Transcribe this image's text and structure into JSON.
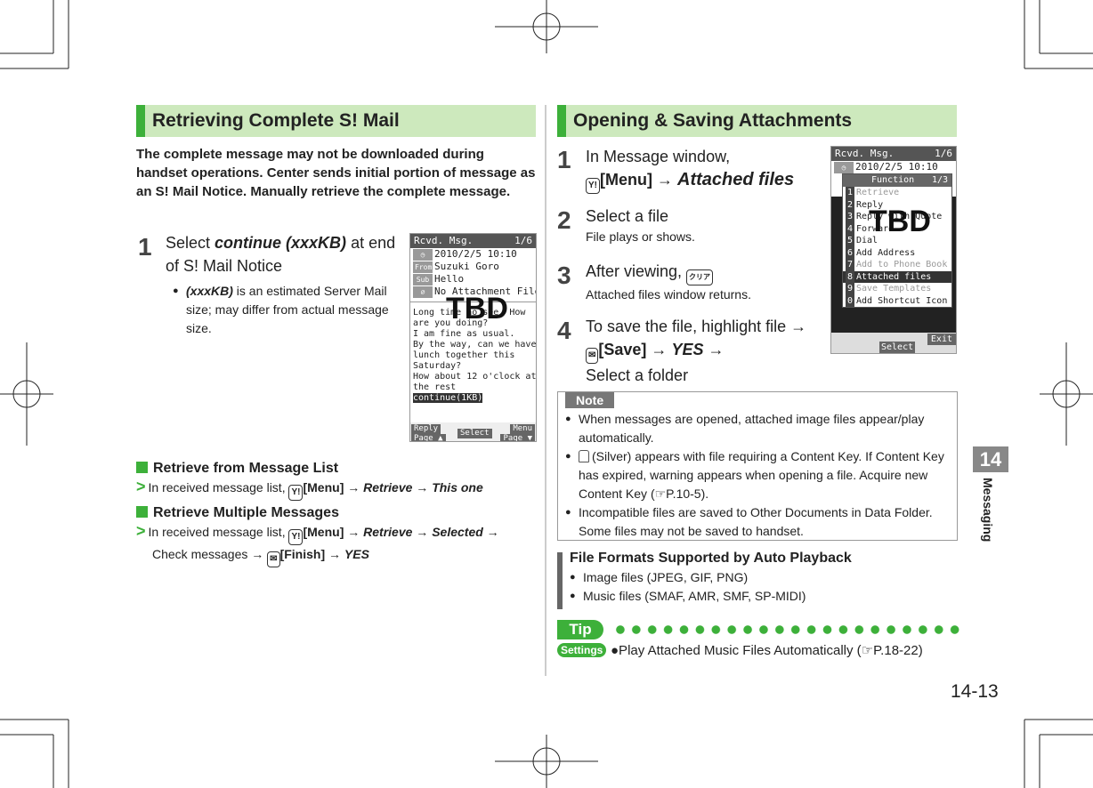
{
  "left": {
    "section_title": "Retrieving Complete S! Mail",
    "intro": "The complete message may not be downloaded during handset operations. Center sends initial portion of message as an S! Mail Notice. Manually retrieve the complete message.",
    "step1": {
      "num": "1",
      "pre": "Select ",
      "target": "continue (xxxKB)",
      "post": " at end of S! Mail Notice",
      "bullet_term": "(xxxKB)",
      "bullet_text": " is an estimated Server Mail size; may differ from actual message size."
    },
    "phone": {
      "title": "Rcvd. Msg.",
      "page": "1/6",
      "date": "2010/2/5 10:10",
      "from_tag": "From",
      "from": "Suzuki Goro",
      "sub_tag": "Sub",
      "subject": "Hello",
      "attach": "No Attachment File",
      "body": [
        "Long time no see. How",
        "are you doing?",
        "I am fine as usual.",
        "By the way, can we have",
        " lunch together this",
        "Saturday?",
        "How about 12 o'clock at",
        " the rest"
      ],
      "continue": "continue(1KB)",
      "reply": "Reply",
      "menu": "Menu",
      "select": "Select",
      "page_up": "Page ▲",
      "page_down": "Page ▼",
      "placeholder": "TBD"
    },
    "sub1": {
      "title": "Retrieve from Message List",
      "text": "In received message list, ",
      "key": "Y!",
      "menu": "[Menu]",
      "a1": "Retrieve",
      "a2": "This one"
    },
    "sub2": {
      "title": "Retrieve Multiple Messages",
      "text": "In received message list, ",
      "key": "Y!",
      "menu": "[Menu]",
      "a1": "Retrieve",
      "a2": "Selected",
      "line2": "Check messages",
      "key2": "✉",
      "finish": "[Finish]",
      "yes": "YES"
    }
  },
  "right": {
    "section_title": "Opening & Saving Attachments",
    "steps": [
      {
        "num": "1",
        "text": "In Message window,",
        "key": "Y!",
        "menu": "[Menu]",
        "target": "Attached files"
      },
      {
        "num": "2",
        "text": "Select a file",
        "sub": "File plays or shows."
      },
      {
        "num": "3",
        "text": "After viewing, ",
        "key": "クリア",
        "sub": "Attached files window returns."
      },
      {
        "num": "4",
        "text": "To save the file, highlight file",
        "key": "✉",
        "save": "[Save]",
        "yes": "YES",
        "last": "Select a folder"
      }
    ],
    "phone": {
      "title": "Rcvd. Msg.",
      "page": "1/6",
      "date": "2010/2/5 10:10",
      "menu_title": "Function",
      "menu_page": "1/3",
      "items": [
        {
          "n": "1",
          "label": "Retrieve",
          "dim": true
        },
        {
          "n": "2",
          "label": "Reply"
        },
        {
          "n": "3",
          "label": "Reply with Quote"
        },
        {
          "n": "4",
          "label": "Forward"
        },
        {
          "n": "5",
          "label": "Dial"
        },
        {
          "n": "6",
          "label": "Add Address"
        },
        {
          "n": "7",
          "label": "Add to Phone Book",
          "dim": true
        },
        {
          "n": "8",
          "label": "Attached files",
          "selected": true
        },
        {
          "n": "9",
          "label": "Save Templates",
          "dim": true
        },
        {
          "n": "0",
          "label": "Add Shortcut Icon"
        }
      ],
      "select": "Select",
      "exit": "Exit",
      "placeholder": "TBD"
    },
    "note": {
      "label": "Note",
      "items": [
        "When messages are opened, attached image files appear/play automatically.",
        "(Silver) appears with file requiring a Content Key. If Content Key has expired, warning appears when opening a file. Acquire new Content Key (☞P.10-5).",
        "Incompatible files are saved to Other Documents in Data Folder. Some files may not be saved to handset."
      ]
    },
    "formats": {
      "title": "File Formats Supported by Auto Playback",
      "items": [
        "Image files (JPEG, GIF, PNG)",
        "Music files (SMAF, AMR, SMF, SP-MIDI)"
      ]
    },
    "tip": {
      "label": "Tip",
      "settings": "Settings",
      "text": "●Play Attached Music Files Automatically (☞P.18-22)"
    }
  },
  "side": {
    "chapter": "14",
    "label": "Messaging"
  },
  "page_number": "14-13",
  "colors": {
    "accent": "#3db03a",
    "header_bg": "#cde9bd"
  }
}
